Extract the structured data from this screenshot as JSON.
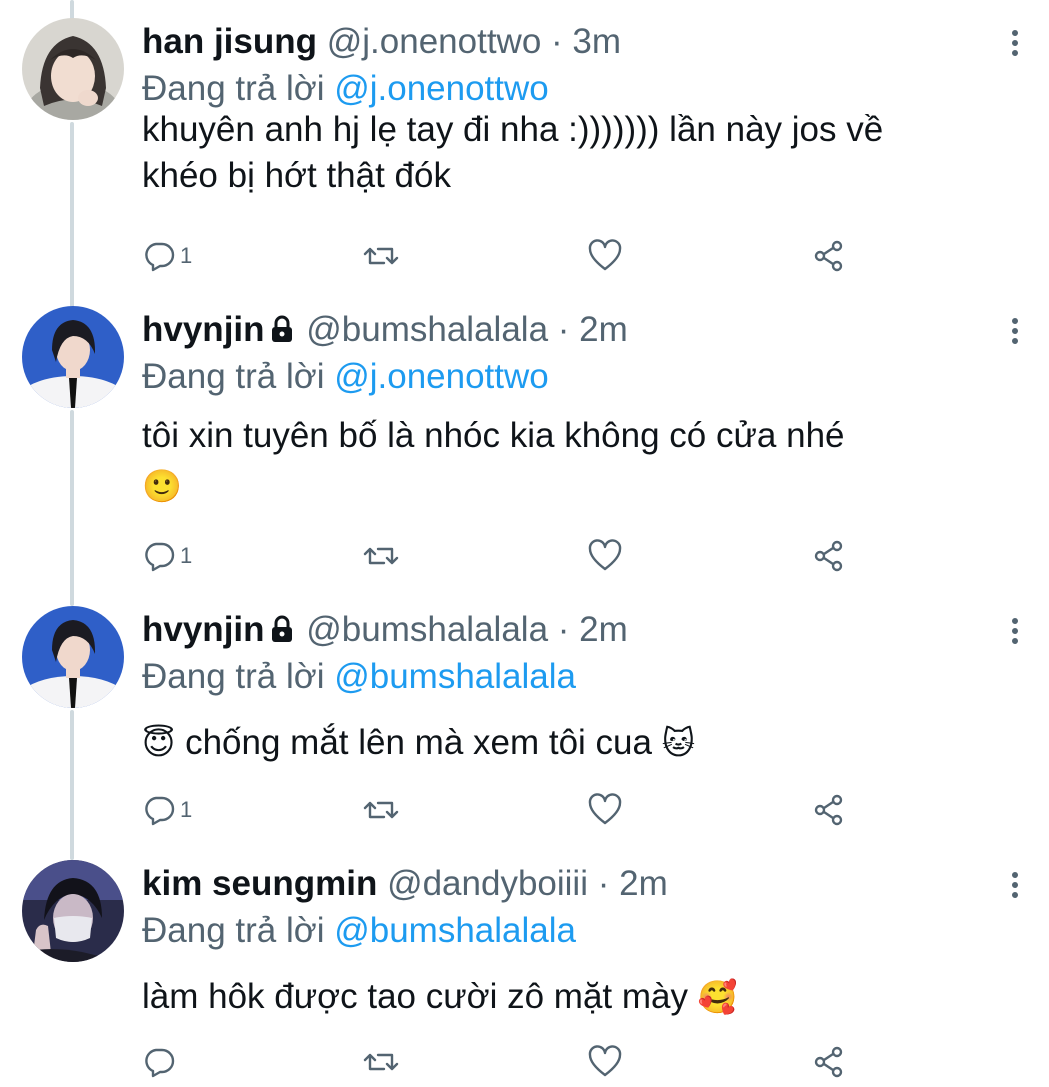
{
  "replying_prefix": "Đang trả lời",
  "tweets": [
    {
      "name": "han jisung",
      "handle": "@j.onenottwo",
      "sep": "·",
      "time": "3m",
      "reply_to": "@j.onenottwo",
      "text_line1": "khuyên anh hj lẹ tay đi nha :))))))) lần này jos về",
      "text_line2": "khéo bị hớt thật đók",
      "reply_count": "1",
      "protected": false
    },
    {
      "name": "hvynjin",
      "handle": "@bumshalalala",
      "sep": "·",
      "time": "2m",
      "reply_to": "@j.onenottwo",
      "text_line1": "tôi xin tuyên bố là nhóc kia không có cửa nhé",
      "text_emoji_after": "🙂",
      "reply_count": "1",
      "protected": true
    },
    {
      "name": "hvynjin",
      "handle": "@bumshalalala",
      "sep": "·",
      "time": "2m",
      "reply_to": "@bumshalalala",
      "emoji_before": "😇",
      "text_line1": "chống mắt lên mà xem tôi cua",
      "emoji_after": "🐱",
      "reply_count": "1",
      "protected": true
    },
    {
      "name": "kim seungmin",
      "handle": "@dandyboiiii",
      "sep": "·",
      "time": "2m",
      "reply_to": "@bumshalalala",
      "text_line1": "làm hôk được tao cười zô mặt mày",
      "emoji_after": "🥰",
      "reply_count": "",
      "protected": false
    }
  ],
  "icons": {
    "reply": "reply-icon",
    "retweet": "retweet-icon",
    "like": "heart-icon",
    "share": "share-icon",
    "more": "more-icon",
    "lock": "lock-icon"
  },
  "colors": {
    "name": "#0f1419",
    "secondary": "#536471",
    "mention": "#1d9bf0",
    "thread_line": "#cfd9de"
  }
}
